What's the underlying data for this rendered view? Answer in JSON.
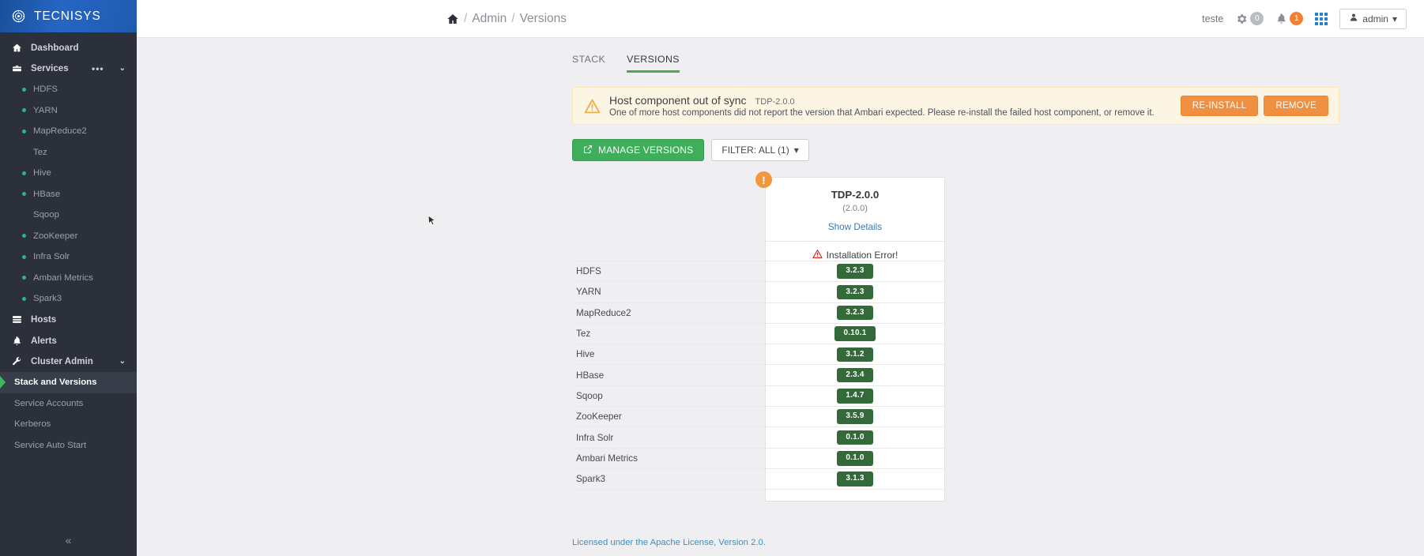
{
  "brand": {
    "name": "TECNISYS",
    "icon": "compass-icon"
  },
  "sidebar": {
    "nav": [
      {
        "label": "Dashboard",
        "icon": "home-icon"
      },
      {
        "label": "Services",
        "icon": "briefcase-icon",
        "dots": "•••",
        "caret": "⌄"
      }
    ],
    "services": [
      {
        "label": "HDFS",
        "status": "green"
      },
      {
        "label": "YARN",
        "status": "green"
      },
      {
        "label": "MapReduce2",
        "status": "green"
      },
      {
        "label": "Tez",
        "status": "none"
      },
      {
        "label": "Hive",
        "status": "green"
      },
      {
        "label": "HBase",
        "status": "green"
      },
      {
        "label": "Sqoop",
        "status": "none"
      },
      {
        "label": "ZooKeeper",
        "status": "green"
      },
      {
        "label": "Infra Solr",
        "status": "green"
      },
      {
        "label": "Ambari Metrics",
        "status": "green"
      },
      {
        "label": "Spark3",
        "status": "green"
      }
    ],
    "nav2": [
      {
        "label": "Hosts",
        "icon": "hosts-icon"
      },
      {
        "label": "Alerts",
        "icon": "bell-icon"
      },
      {
        "label": "Cluster Admin",
        "icon": "wrench-icon",
        "caret": "⌄"
      }
    ],
    "admin_items": [
      {
        "label": "Stack and Versions",
        "active": true
      },
      {
        "label": "Service Accounts",
        "active": false
      },
      {
        "label": "Kerberos",
        "active": false
      },
      {
        "label": "Service Auto Start",
        "active": false
      }
    ],
    "collapse_icon": "«"
  },
  "topbar": {
    "breadcrumb": {
      "home_icon": "home-icon",
      "items": [
        "Admin",
        "Versions"
      ],
      "separator": "/"
    },
    "cluster_name": "teste",
    "ops_icon": "gear-icon",
    "ops_count": "0",
    "alerts_icon": "bell-icon",
    "alerts_count": "1",
    "apps_icon": "grid-icon",
    "user": {
      "label": "admin",
      "icon": "user-icon",
      "caret": "▾"
    }
  },
  "tabs": [
    {
      "label": "STACK",
      "active": false
    },
    {
      "label": "VERSIONS",
      "active": true
    }
  ],
  "alert": {
    "icon": "warning-triangle-icon",
    "title": "Host component out of sync",
    "version": "TDP-2.0.0",
    "description": "One of more host components did not report the version that Ambari expected. Please re-install the failed host component, or remove it.",
    "buttons": [
      {
        "label": "RE-INSTALL"
      },
      {
        "label": "REMOVE"
      }
    ]
  },
  "toolbar": {
    "manage_versions": {
      "label": "MANAGE VERSIONS",
      "icon": "external-link-icon"
    },
    "filter": {
      "label": "FILTER: ALL (1)",
      "caret": "▾"
    }
  },
  "version_card": {
    "error_badge": "!",
    "title": "TDP-2.0.0",
    "subtitle": "(2.0.0)",
    "details_link": "Show Details",
    "status_icon": "red-warning-icon",
    "status_text": "Installation Error!"
  },
  "services_table": {
    "rows": [
      {
        "name": "HDFS",
        "version": "3.2.3"
      },
      {
        "name": "YARN",
        "version": "3.2.3"
      },
      {
        "name": "MapReduce2",
        "version": "3.2.3"
      },
      {
        "name": "Tez",
        "version": "0.10.1"
      },
      {
        "name": "Hive",
        "version": "3.1.2"
      },
      {
        "name": "HBase",
        "version": "2.3.4"
      },
      {
        "name": "Sqoop",
        "version": "1.4.7"
      },
      {
        "name": "ZooKeeper",
        "version": "3.5.9"
      },
      {
        "name": "Infra Solr",
        "version": "0.1.0"
      },
      {
        "name": "Ambari Metrics",
        "version": "0.1.0"
      },
      {
        "name": "Spark3",
        "version": "3.1.3"
      }
    ]
  },
  "footer": {
    "license_text": "Licensed under the Apache License, Version 2.0."
  },
  "colors": {
    "brand_blue": "#2566c4",
    "sidebar_bg": "#2b303b",
    "green_accent": "#3fae5a",
    "chip_green": "#34693a",
    "orange": "#ef9040",
    "alert_bg": "#fcf5e3",
    "link_blue": "#337ab7"
  }
}
